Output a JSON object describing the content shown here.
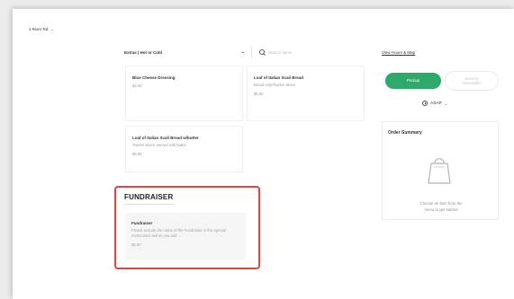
{
  "header": {
    "location": "1 River Rd"
  },
  "menu": {
    "category": "Extras | Hot or Cold",
    "search_placeholder": "Search items",
    "items": [
      {
        "name": "Blue Cheese Dressing",
        "description": "",
        "price": "$4.00"
      },
      {
        "name": "Loaf of Italian Scali Bread",
        "description": "Bread only!Twelve slices",
        "price": "$5.50"
      },
      {
        "name": "Loaf of Italian Scali Bread w/butter",
        "description": "Twelve slices, served with butter",
        "price": "$5.95"
      }
    ],
    "fundraiser": {
      "heading": "FUNDRAISER",
      "item": {
        "name": "Fundraiser",
        "description": "Please include the name of the Fundraiser in the Special Instructions before you add ...",
        "price": "$5.00"
      }
    }
  },
  "sidebar": {
    "hours_link": "View Hours & Map",
    "pickup": "Pickup",
    "delivery_line1": "Delivery",
    "delivery_line2": "unavailable",
    "timing": "ASAP",
    "order_summary_title": "Order Summary",
    "empty_line1": "Choose an item from the",
    "empty_line2": "menu to get started"
  },
  "colors": {
    "accent": "#2daa6a",
    "highlight": "#e0443a"
  }
}
